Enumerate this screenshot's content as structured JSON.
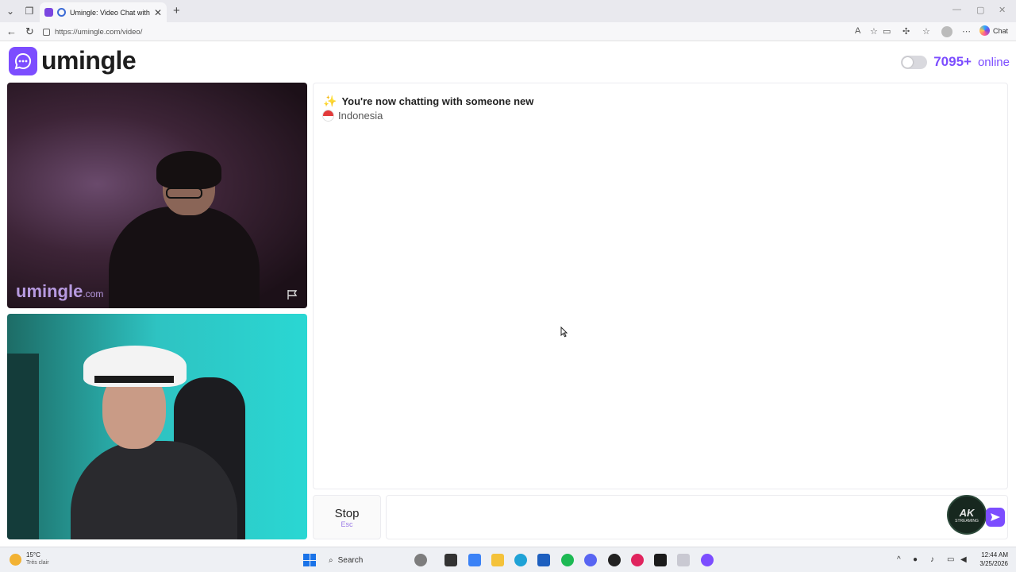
{
  "browser": {
    "tab_title": "Umingle: Video Chat with Stra",
    "url": "https://umingle.com/video/",
    "copilot_label": "Chat"
  },
  "header": {
    "logo_text": "umingle",
    "online_count": "7095+",
    "online_label": "online"
  },
  "video": {
    "watermark": "umingle",
    "watermark_domain": ".com"
  },
  "chat": {
    "status_message": "You're now chatting with someone new",
    "partner_country": "Indonesia"
  },
  "controls": {
    "stop_label": "Stop",
    "stop_key": "Esc",
    "message_value": "",
    "badge_text": "AK",
    "badge_subtext": "STREAMING"
  },
  "taskbar": {
    "temperature": "15°C",
    "weather_desc": "Très clair",
    "search_label": "Search",
    "time": "12:44 AM",
    "date": "3/25/2026"
  },
  "colors": {
    "brand": "#7c4dff",
    "self_video_bg": "#2ec3c2"
  }
}
